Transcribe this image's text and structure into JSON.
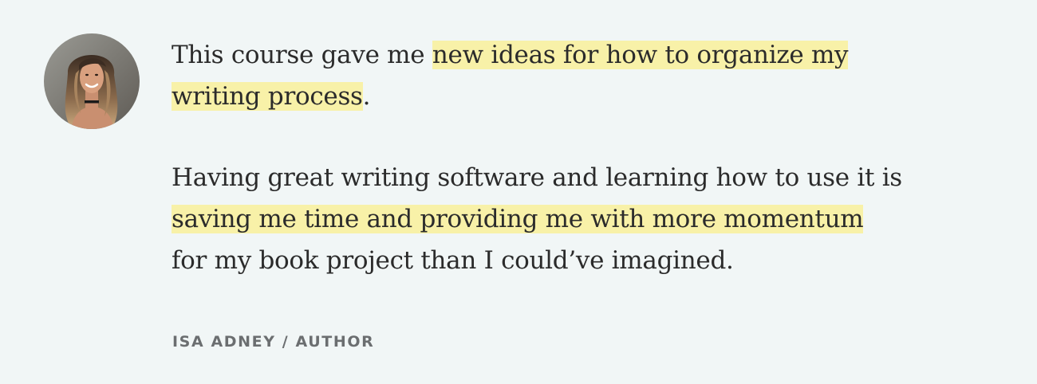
{
  "testimonial": {
    "avatar_icon": "person-photo-avatar",
    "highlight_color": "#f8f1a8",
    "paragraph1": {
      "line1_before": "This course gave me ",
      "line1_highlight": "new ideas for how to organize my",
      "line2_highlight": "writing process",
      "line2_after": "."
    },
    "paragraph2": {
      "line1": "Having great writing software and learning how to use it is",
      "line2_highlight": "saving me time and providing me with more momentum",
      "line3": "for my book project than I could’ve imagined."
    },
    "attribution": "ISA ADNEY / AUTHOR"
  }
}
